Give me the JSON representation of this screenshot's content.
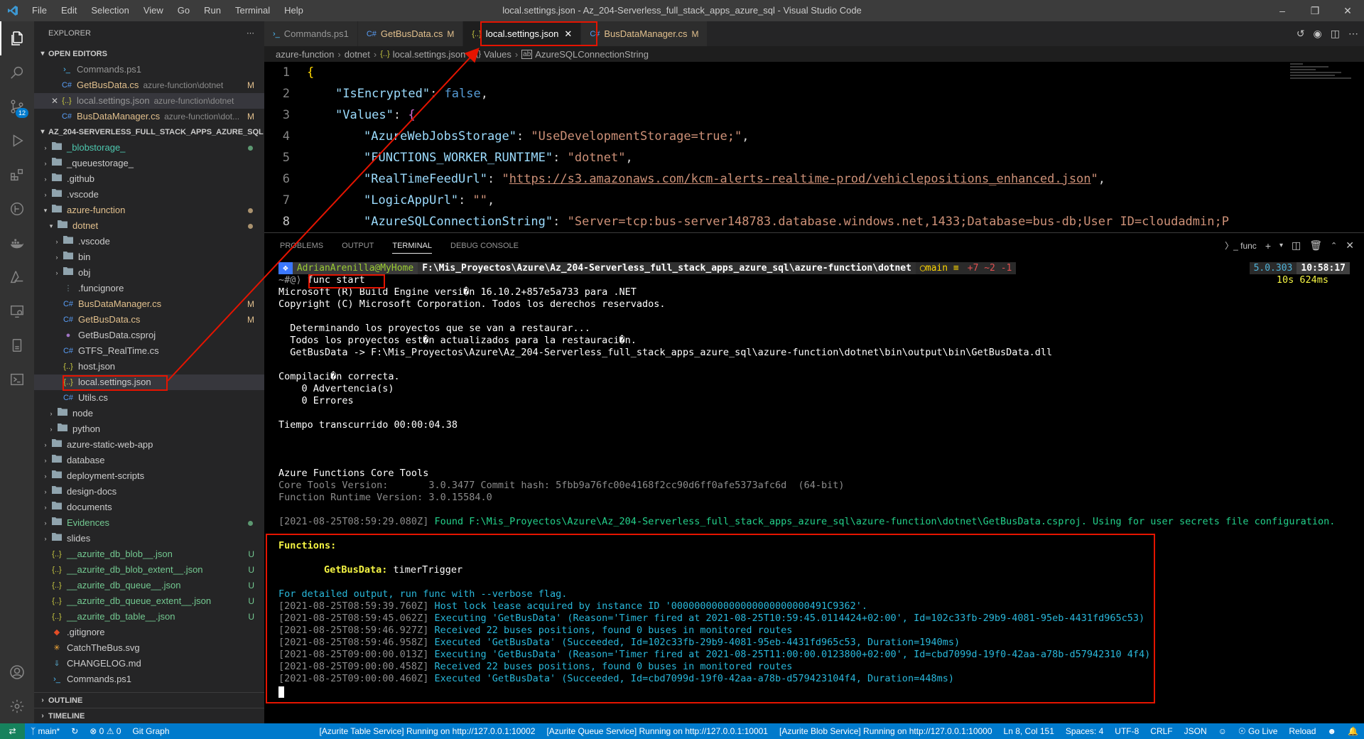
{
  "window": {
    "title": "local.settings.json - Az_204-Serverless_full_stack_apps_azure_sql - Visual Studio Code",
    "menu": [
      "File",
      "Edit",
      "Selection",
      "View",
      "Go",
      "Run",
      "Terminal",
      "Help"
    ]
  },
  "activity_bar": {
    "scm_badge": "12"
  },
  "sidebar": {
    "header": "EXPLORER",
    "open_editors_title": "OPEN EDITORS",
    "open_editors": [
      {
        "name": "Commands.ps1",
        "desc": "",
        "status": ""
      },
      {
        "name": "GetBusData.cs",
        "desc": "azure-function\\dotnet",
        "status": "M"
      },
      {
        "name": "local.settings.json",
        "desc": "azure-function\\dotnet",
        "status": ""
      },
      {
        "name": "BusDataManager.cs",
        "desc": "azure-function\\dot...",
        "status": "M"
      }
    ],
    "workspace_title": "AZ_204-SERVERLESS_FULL_STACK_APPS_AZURE_SQL",
    "tree": [
      {
        "name": "_blobstorage_",
        "status": ""
      },
      {
        "name": "_queuestorage_",
        "status": ""
      },
      {
        "name": ".github",
        "status": ""
      },
      {
        "name": ".vscode",
        "status": ""
      },
      {
        "name": "azure-function",
        "status": ""
      },
      {
        "name": "dotnet",
        "status": ""
      },
      {
        "name": ".vscode",
        "status": ""
      },
      {
        "name": "bin",
        "status": ""
      },
      {
        "name": "obj",
        "status": ""
      },
      {
        "name": ".funcignore",
        "status": ""
      },
      {
        "name": "BusDataManager.cs",
        "status": "M"
      },
      {
        "name": "GetBusData.cs",
        "status": "M"
      },
      {
        "name": "GetBusData.csproj",
        "status": ""
      },
      {
        "name": "GTFS_RealTime.cs",
        "status": ""
      },
      {
        "name": "host.json",
        "status": ""
      },
      {
        "name": "local.settings.json",
        "status": ""
      },
      {
        "name": "Utils.cs",
        "status": ""
      },
      {
        "name": "node",
        "status": ""
      },
      {
        "name": "python",
        "status": ""
      },
      {
        "name": "azure-static-web-app",
        "status": ""
      },
      {
        "name": "database",
        "status": ""
      },
      {
        "name": "deployment-scripts",
        "status": ""
      },
      {
        "name": "design-docs",
        "status": ""
      },
      {
        "name": "documents",
        "status": ""
      },
      {
        "name": "Evidences",
        "status": ""
      },
      {
        "name": "slides",
        "status": ""
      },
      {
        "name": "__azurite_db_blob__.json",
        "status": "U"
      },
      {
        "name": "__azurite_db_blob_extent__.json",
        "status": "U"
      },
      {
        "name": "__azurite_db_queue__.json",
        "status": "U"
      },
      {
        "name": "__azurite_db_queue_extent__.json",
        "status": "U"
      },
      {
        "name": "__azurite_db_table__.json",
        "status": "U"
      },
      {
        "name": ".gitignore",
        "status": ""
      },
      {
        "name": "CatchTheBus.svg",
        "status": ""
      },
      {
        "name": "CHANGELOG.md",
        "status": ""
      },
      {
        "name": "Commands.ps1",
        "status": ""
      }
    ],
    "outline_title": "OUTLINE",
    "timeline_title": "TIMELINE"
  },
  "tabs": [
    {
      "label": "Commands.ps1",
      "mark": ""
    },
    {
      "label": "GetBusData.cs",
      "mark": "M"
    },
    {
      "label": "local.settings.json",
      "mark": ""
    },
    {
      "label": "BusDataManager.cs",
      "mark": "M"
    }
  ],
  "breadcrumb": [
    "azure-function",
    "dotnet",
    "local.settings.json",
    "Values",
    "AzureSQLConnectionString"
  ],
  "editor": {
    "line_numbers": [
      "1",
      "2",
      "3",
      "4",
      "5",
      "6",
      "7",
      "8"
    ],
    "lines": [
      {
        "key": "",
        "value": "{"
      },
      {
        "key": "\"IsEncrypted\"",
        "value": "false"
      },
      {
        "key": "\"Values\"",
        "value": "{"
      },
      {
        "key": "\"AzureWebJobsStorage\"",
        "value": "\"UseDevelopmentStorage=true;\""
      },
      {
        "key": "\"FUNCTIONS_WORKER_RUNTIME\"",
        "value": "\"dotnet\""
      },
      {
        "key": "\"RealTimeFeedUrl\"",
        "value": "https://s3.amazonaws.com/kcm-alerts-realtime-prod/vehiclepositions_enhanced.json"
      },
      {
        "key": "\"LogicAppUrl\"",
        "value": "\"\""
      },
      {
        "key": "\"AzureSQLConnectionString\"",
        "value": "\"Server=tcp:bus-server148783.database.windows.net,1433;Database=bus-db;User ID=cloudadmin;P"
      }
    ]
  },
  "panel": {
    "tabs": [
      "PROBLEMS",
      "OUTPUT",
      "TERMINAL",
      "DEBUG CONSOLE"
    ],
    "terminal_name": "func",
    "prompt": {
      "user": "AdrianArenilla@MyHome",
      "path": "F:\\Mis_Proyectos\\Azure\\Az_204-Serverless_full_stack_apps_azure_sql\\azure-function\\dotnet",
      "branch": "main ≡",
      "git_status": "+7 ~2 -1",
      "dotnet": "5.0.303",
      "clock": "10:58:17",
      "duration": "10s 624ms",
      "history": "~#@⟩",
      "command": "func start"
    },
    "output_lines": [
      "Microsoft (R) Build Engine versi�n 16.10.2+857e5a733 para .NET",
      "Copyright (C) Microsoft Corporation. Todos los derechos reservados.",
      "",
      "  Determinando los proyectos que se van a restaurar...",
      "  Todos los proyectos est�n actualizados para la restauraci�n.",
      "  GetBusData -> F:\\Mis_Proyectos\\Azure\\Az_204-Serverless_full_stack_apps_azure_sql\\azure-function\\dotnet\\bin\\output\\bin\\GetBusData.dll",
      "",
      "Compilaci�n correcta.",
      "    0 Advertencia(s)",
      "    0 Errores",
      "",
      "Tiempo transcurrido 00:00:04.38",
      "",
      "",
      "",
      "Azure Functions Core Tools"
    ],
    "core_tools_version_label": "Core Tools Version:",
    "core_tools_version": "3.0.3477 Commit hash: 5fbb9a76fc00e4168f2cc90d6ff0afe5373afc6d  (64-bit)",
    "runtime_version_label": "Function Runtime Version:",
    "runtime_version": "3.0.15584.0",
    "found_line_ts": "[2021-08-25T08:59:29.080Z]",
    "found_line": "Found F:\\Mis_Proyectos\\Azure\\Az_204-Serverless_full_stack_apps_azure_sql\\azure-function\\dotnet\\GetBusData.csproj. Using for user secrets file configuration.",
    "functions_header": "Functions:",
    "function_name": "GetBusData:",
    "function_trigger": "timerTrigger",
    "verbose_hint": "For detailed output, run func with --verbose flag.",
    "log_lines": [
      {
        "ts": "[2021-08-25T08:59:39.760Z]",
        "msg": "Host lock lease acquired by instance ID '000000000000000000000000491C9362'."
      },
      {
        "ts": "[2021-08-25T08:59:45.062Z]",
        "msg": "Executing 'GetBusData' (Reason='Timer fired at 2021-08-25T10:59:45.0114424+02:00', Id=102c33fb-29b9-4081-95eb-4431fd965c53)"
      },
      {
        "ts": "[2021-08-25T08:59:46.927Z]",
        "msg": "Received 22 buses positions, found 0 buses in monitored routes"
      },
      {
        "ts": "[2021-08-25T08:59:46.958Z]",
        "msg": "Executed 'GetBusData' (Succeeded, Id=102c33fb-29b9-4081-95eb-4431fd965c53, Duration=1940ms)"
      },
      {
        "ts": "[2021-08-25T09:00:00.013Z]",
        "msg": "Executing 'GetBusData' (Reason='Timer fired at 2021-08-25T11:00:00.0123800+02:00', Id=cbd7099d-19f0-42aa-a78b-d57942310 4f4)"
      },
      {
        "ts": "[2021-08-25T09:00:00.458Z]",
        "msg": "Received 22 buses positions, found 0 buses in monitored routes"
      },
      {
        "ts": "[2021-08-25T09:00:00.460Z]",
        "msg": "Executed 'GetBusData' (Succeeded, Id=cbd7099d-19f0-42aa-a78b-d579423104f4, Duration=448ms)"
      }
    ]
  },
  "statusbar": {
    "branch": "main*",
    "problems": "⊗ 0 ⚠ 0",
    "git_graph": "Git Graph",
    "azurite_table": "[Azurite Table Service] Running on http://127.0.0.1:10002",
    "azurite_queue": "[Azurite Queue Service] Running on http://127.0.0.1:10001",
    "azurite_blob": "[Azurite Blob Service] Running on http://127.0.0.1:10000",
    "position": "Ln 8, Col 151",
    "spaces": "Spaces: 4",
    "encoding": "UTF-8",
    "eol": "CRLF",
    "language": "JSON",
    "golive": "Go Live",
    "reload": "Reload"
  }
}
